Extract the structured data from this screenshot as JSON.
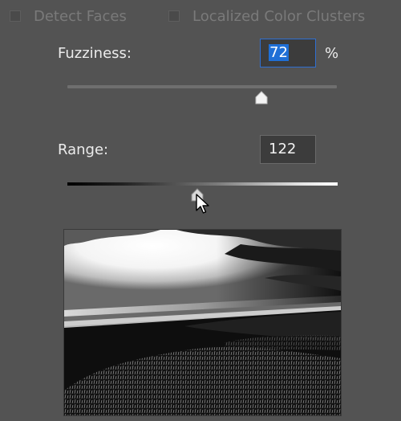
{
  "options": {
    "detect_faces": {
      "label": "Detect Faces",
      "checked": false
    },
    "localized_clusters": {
      "label": "Localized Color Clusters",
      "checked": false
    }
  },
  "fuzziness": {
    "label": "Fuzziness:",
    "value": "72",
    "unit": "%",
    "slider_fraction": 0.72
  },
  "range": {
    "label": "Range:",
    "value": "122",
    "slider_fraction": 0.48
  },
  "colors": {
    "panel_bg": "#535353",
    "focus_blue": "#2f6fd1",
    "selection_blue": "#1f6fd6"
  }
}
